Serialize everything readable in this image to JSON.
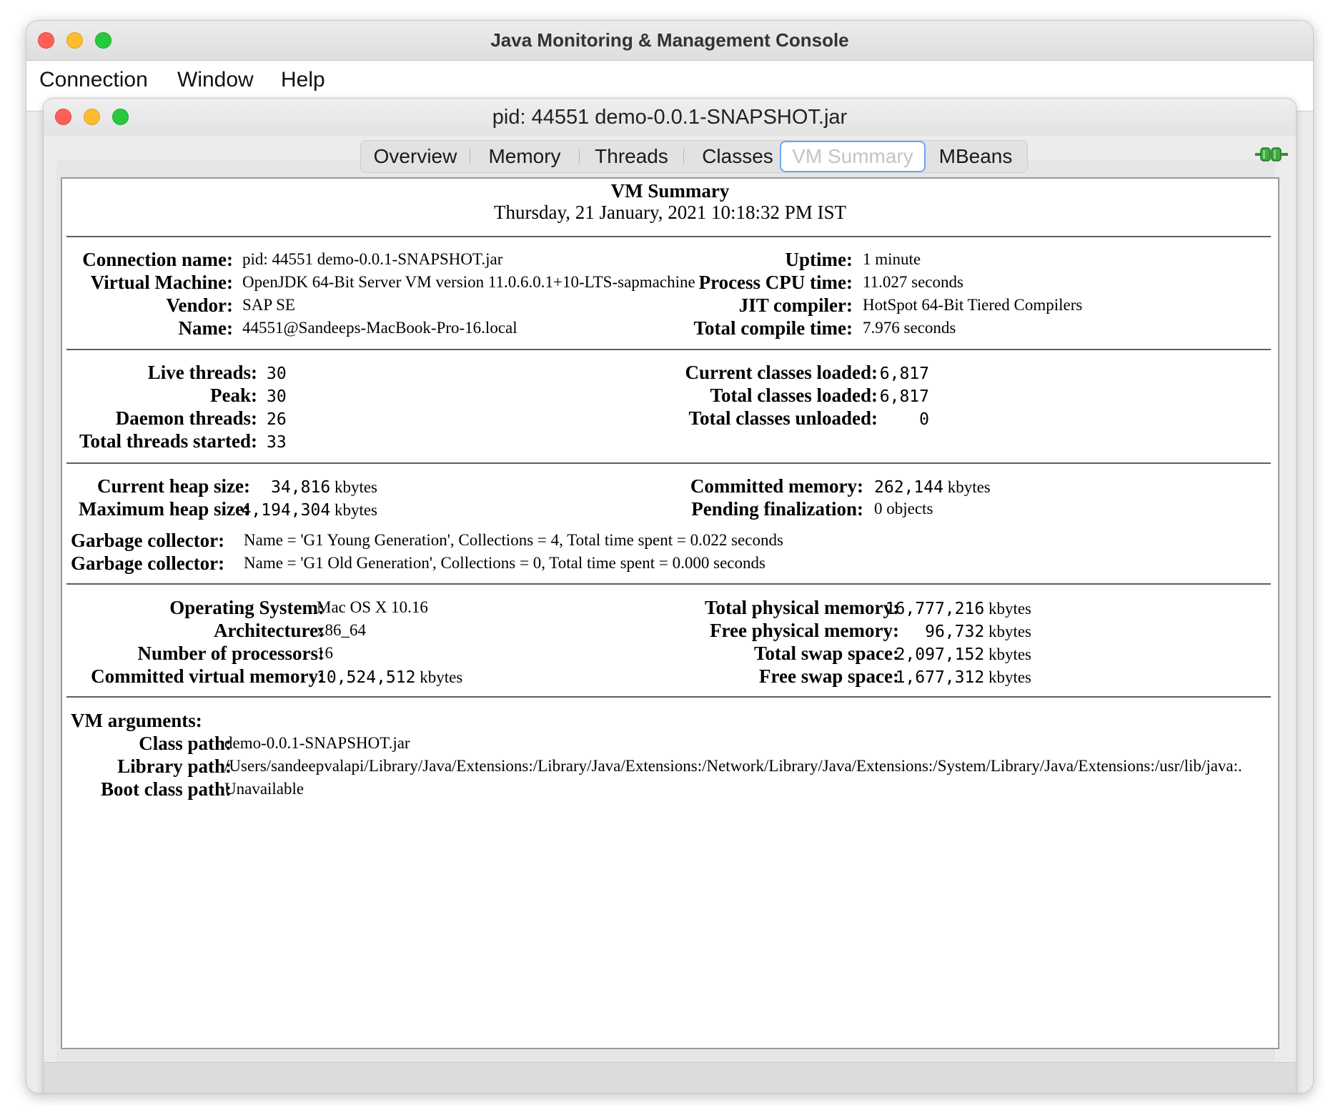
{
  "app": {
    "title": "Java Monitoring & Management Console"
  },
  "menu": [
    "Connection",
    "Window",
    "Help"
  ],
  "inner_window": {
    "title": "pid: 44551 demo-0.0.1-SNAPSHOT.jar"
  },
  "tabs": [
    "Overview",
    "Memory",
    "Threads",
    "Classes",
    "VM Summary",
    "MBeans"
  ],
  "selected_tab": "VM Summary",
  "summary": {
    "title": "VM Summary",
    "datetime": "Thursday, 21 January, 2021 10:18:32 PM IST"
  },
  "section1": {
    "left": [
      {
        "label": "Connection name:",
        "value": "pid: 44551 demo-0.0.1-SNAPSHOT.jar"
      },
      {
        "label": "Virtual Machine:",
        "value": "OpenJDK 64-Bit Server VM version 11.0.6.0.1+10-LTS-sapmachine"
      },
      {
        "label": "Vendor:",
        "value": "SAP SE"
      },
      {
        "label": "Name:",
        "value": "44551@Sandeeps-MacBook-Pro-16.local"
      }
    ],
    "right": [
      {
        "label": "Uptime:",
        "value": "1 minute"
      },
      {
        "label": "Process CPU time:",
        "value": "11.027 seconds"
      },
      {
        "label": "JIT compiler:",
        "value": "HotSpot 64-Bit Tiered Compilers"
      },
      {
        "label": "Total compile time:",
        "value": "7.976 seconds"
      }
    ]
  },
  "section2": {
    "left": [
      {
        "label": "Live threads:",
        "value": "30"
      },
      {
        "label": "Peak:",
        "value": "30"
      },
      {
        "label": "Daemon threads:",
        "value": "26"
      },
      {
        "label": "Total threads started:",
        "value": "33"
      }
    ],
    "right": [
      {
        "label": "Current classes loaded:",
        "value": "6,817"
      },
      {
        "label": "Total classes loaded:",
        "value": "6,817"
      },
      {
        "label": "Total classes unloaded:",
        "value": "0"
      }
    ]
  },
  "section3": {
    "left": [
      {
        "label": "Current heap size:",
        "value": "34,816",
        "unit": "kbytes"
      },
      {
        "label": "Maximum heap size:",
        "value": "4,194,304",
        "unit": "kbytes"
      }
    ],
    "right": [
      {
        "label": "Committed memory:",
        "value": "262,144",
        "unit": "kbytes"
      },
      {
        "label": "Pending finalization:",
        "value": "0 objects"
      }
    ],
    "gc": [
      {
        "label": "Garbage collector:",
        "value": "Name = 'G1 Young Generation', Collections = 4, Total time spent = 0.022 seconds"
      },
      {
        "label": "Garbage collector:",
        "value": "Name = 'G1 Old Generation', Collections = 0, Total time spent = 0.000 seconds"
      }
    ]
  },
  "section4": {
    "left": [
      {
        "label": "Operating System:",
        "value": "Mac OS X 10.16"
      },
      {
        "label": "Architecture:",
        "value": "x86_64"
      },
      {
        "label": "Number of processors:",
        "value": "16"
      },
      {
        "label": "Committed virtual memory:",
        "value": "10,524,512",
        "unit": "kbytes"
      }
    ],
    "right": [
      {
        "label": "Total physical memory:",
        "value": "16,777,216",
        "unit": "kbytes"
      },
      {
        "label": "Free physical memory:",
        "value": "96,732",
        "unit": "kbytes"
      },
      {
        "label": "Total swap space:",
        "value": "2,097,152",
        "unit": "kbytes"
      },
      {
        "label": "Free swap space:",
        "value": "1,677,312",
        "unit": "kbytes"
      }
    ]
  },
  "section5": {
    "header": "VM arguments:",
    "rows": [
      {
        "label": "Class path:",
        "value": "demo-0.0.1-SNAPSHOT.jar"
      },
      {
        "label": "Library path:",
        "value": "/Users/sandeepvalapi/Library/Java/Extensions:/Library/Java/Extensions:/Network/Library/Java/Extensions:/System/Library/Java/Extensions:/usr/lib/java:."
      },
      {
        "label": "Boot class path:",
        "value": "Unavailable"
      }
    ]
  }
}
